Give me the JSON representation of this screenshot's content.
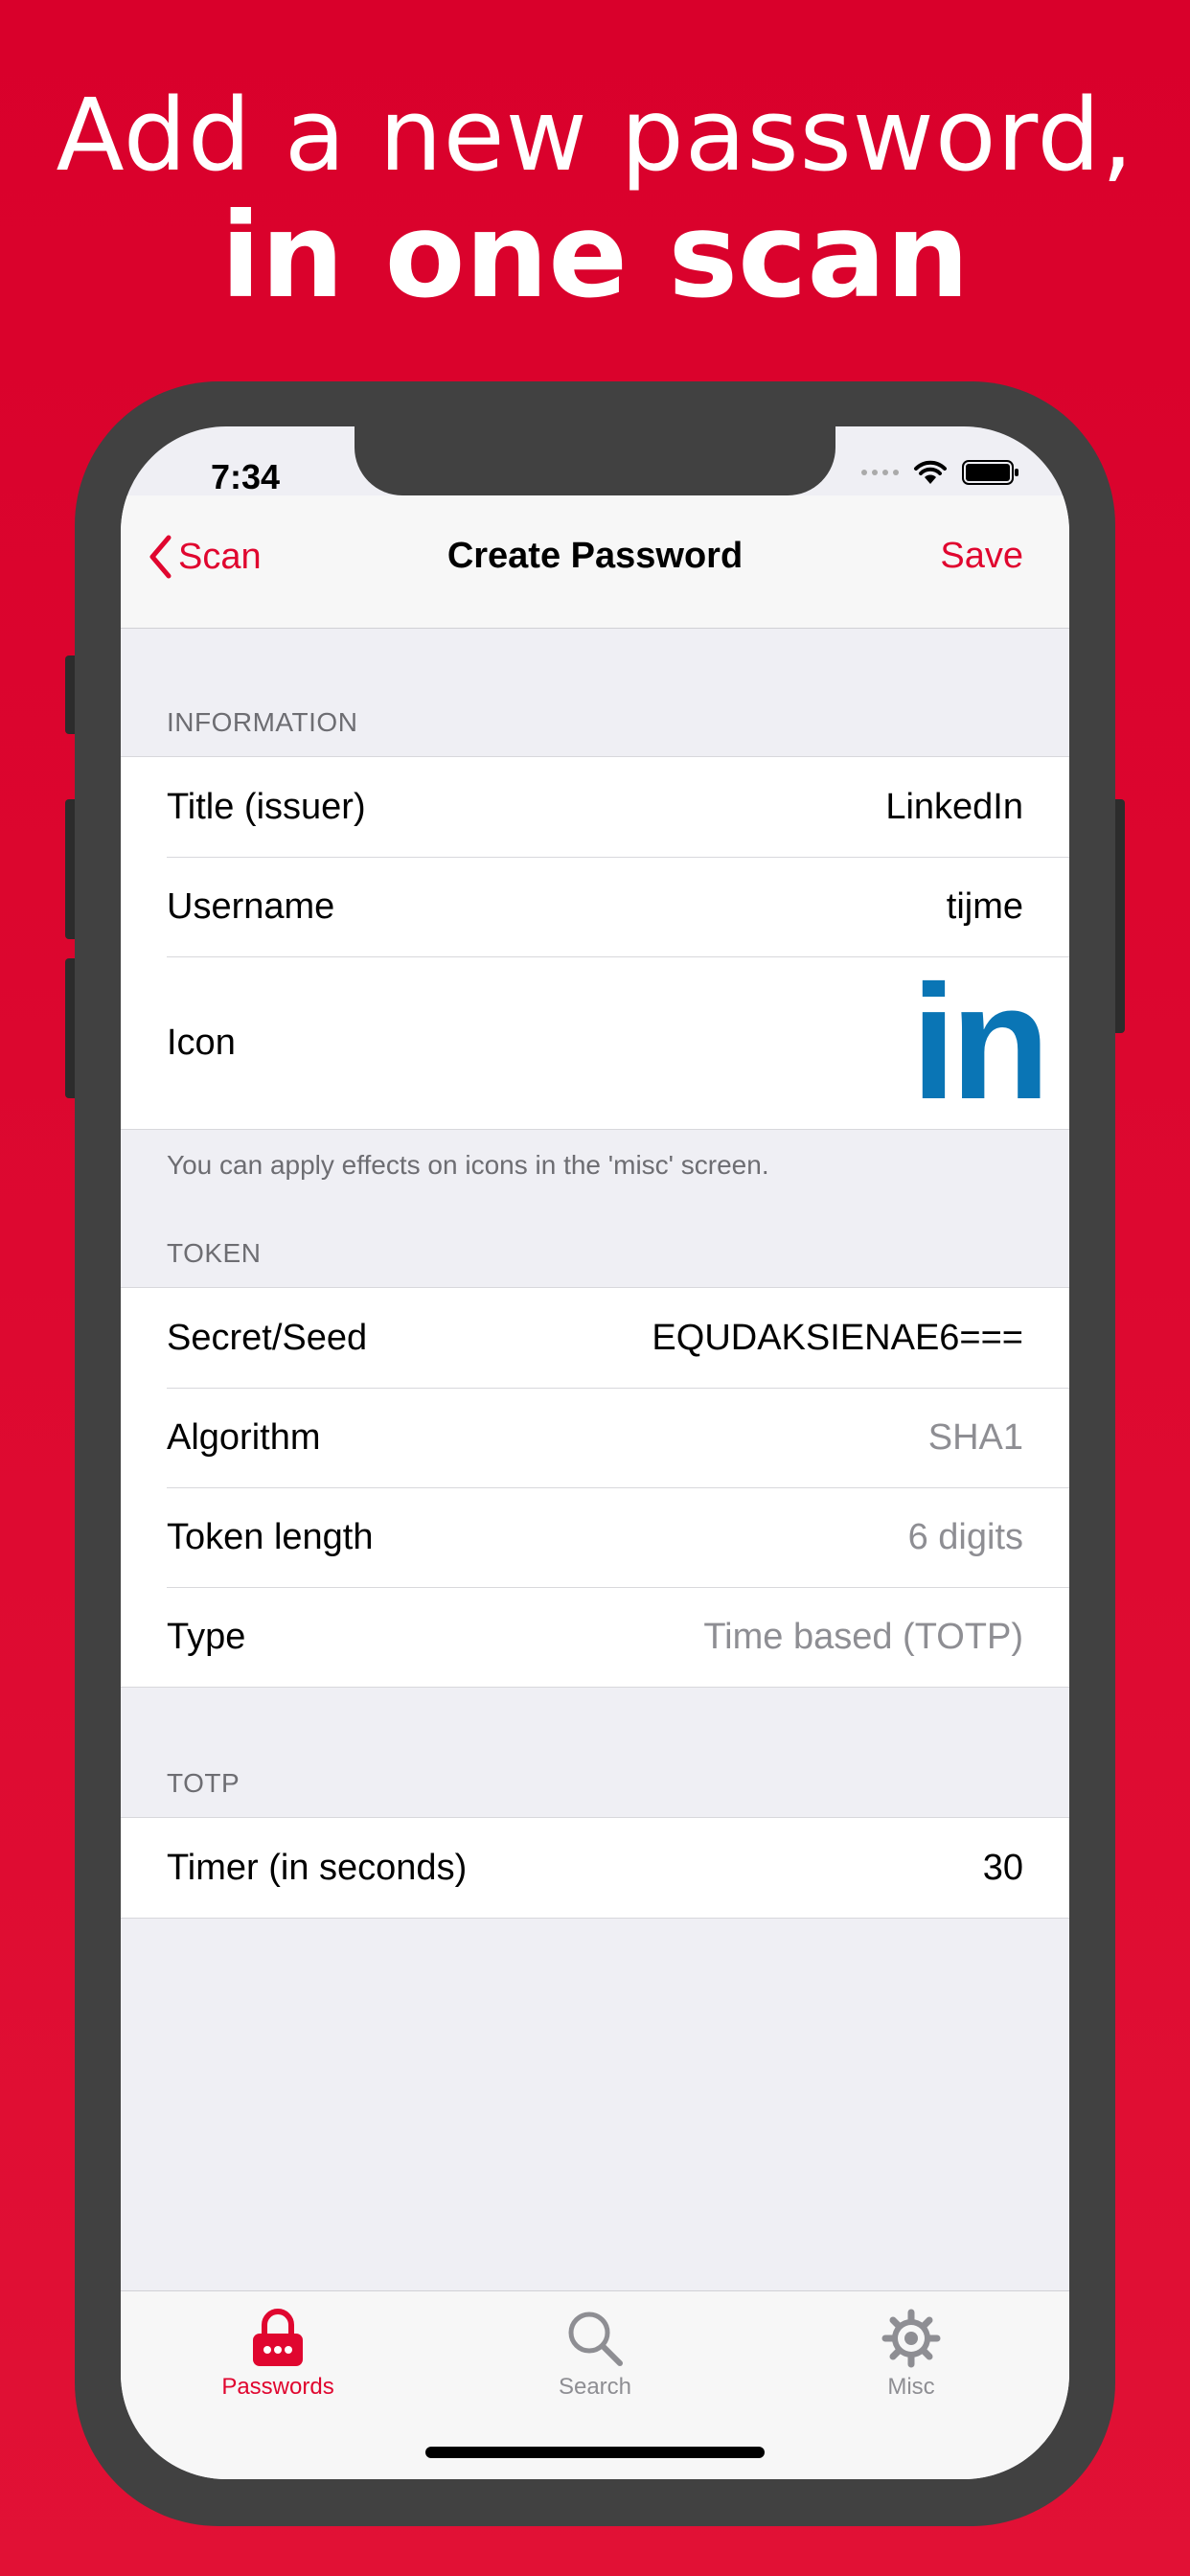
{
  "marketing": {
    "headline_line1": "Add a new password,",
    "headline_line2": "in one scan"
  },
  "status_bar": {
    "time": "7:34"
  },
  "nav": {
    "back_label": "Scan",
    "title": "Create Password",
    "save_label": "Save"
  },
  "information": {
    "header": "INFORMATION",
    "rows": [
      {
        "label": "Title (issuer)",
        "value": "LinkedIn"
      },
      {
        "label": "Username",
        "value": "tijme"
      },
      {
        "label": "Icon",
        "value": "in"
      }
    ],
    "footer": "You can apply effects on icons in the 'misc' screen."
  },
  "token": {
    "header": "TOKEN",
    "rows": [
      {
        "label": "Secret/Seed",
        "value": "EQUDAKSIENAE6==="
      },
      {
        "label": "Algorithm",
        "value": "SHA1"
      },
      {
        "label": "Token length",
        "value": "6 digits"
      },
      {
        "label": "Type",
        "value": "Time based (TOTP)"
      }
    ]
  },
  "totp": {
    "header": "TOTP",
    "rows": [
      {
        "label": "Timer (in seconds)",
        "value": "30"
      }
    ]
  },
  "tabs": [
    {
      "label": "Passwords",
      "icon": "lock-icon",
      "active": true
    },
    {
      "label": "Search",
      "icon": "magnifier-icon",
      "active": false
    },
    {
      "label": "Misc",
      "icon": "gear-icon",
      "active": false
    }
  ],
  "colors": {
    "brand_red": "#e0062f",
    "background_red": "#d9002b",
    "linkedin_blue": "#0a75b5"
  }
}
